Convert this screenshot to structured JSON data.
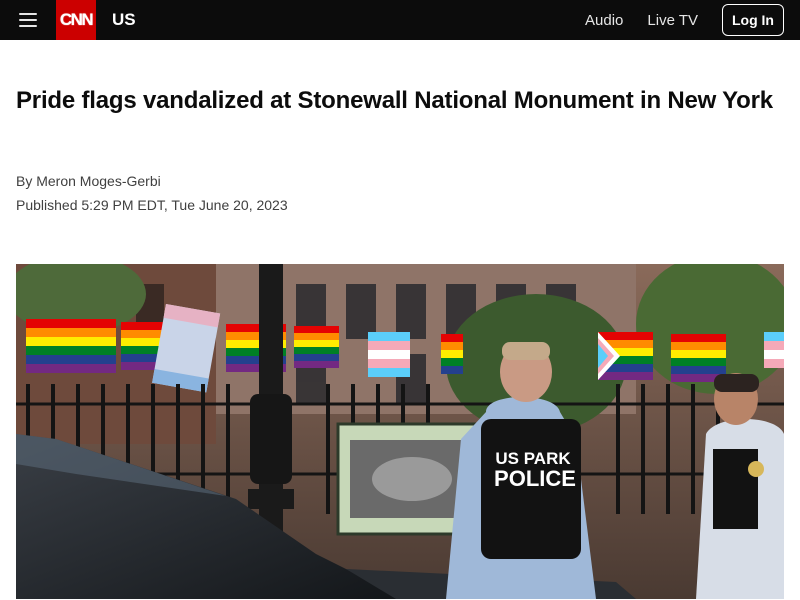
{
  "header": {
    "brand": "CNN",
    "section": "US",
    "nav": [
      "Audio",
      "Live TV"
    ],
    "login_label": "Log In",
    "menu_icon": "hamburger-icon"
  },
  "article": {
    "headline": "Pride flags vandalized at Stonewall National Monument in New York",
    "byline": "By Meron Moges-Gerbi",
    "published": "Published 5:29 PM EDT, Tue June 20, 2023"
  },
  "photo": {
    "vest_text_line1": "US PARK",
    "vest_text_line2": "POLICE"
  },
  "colors": {
    "topbar": "#0c0c0c",
    "brand_red": "#cc0000"
  }
}
